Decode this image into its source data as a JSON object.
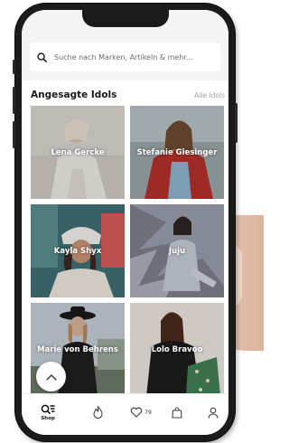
{
  "search": {
    "placeholder": "Suche nach Marken, Artikeln & mehr..."
  },
  "section": {
    "title": "Angesagte Idols",
    "link": "Alle Idols"
  },
  "idols": [
    {
      "name": "Lena Gercke"
    },
    {
      "name": "Stefanie Giesinger"
    },
    {
      "name": "Kayla Shyx"
    },
    {
      "name": "Juju"
    },
    {
      "name": "Marie von Behrens"
    },
    {
      "name": "Lolo Bravoo"
    }
  ],
  "tabs": [
    {
      "label": "Shop",
      "icon": "shop-icon",
      "active": true
    },
    {
      "label": "",
      "icon": "flame-icon"
    },
    {
      "label": "",
      "icon": "heart-icon",
      "count": "79"
    },
    {
      "label": "",
      "icon": "bag-icon"
    },
    {
      "label": "",
      "icon": "profile-icon"
    }
  ],
  "colors": {
    "accent": "#111111",
    "background": "#f4f4f4",
    "muted_text": "#a3a3a3"
  }
}
